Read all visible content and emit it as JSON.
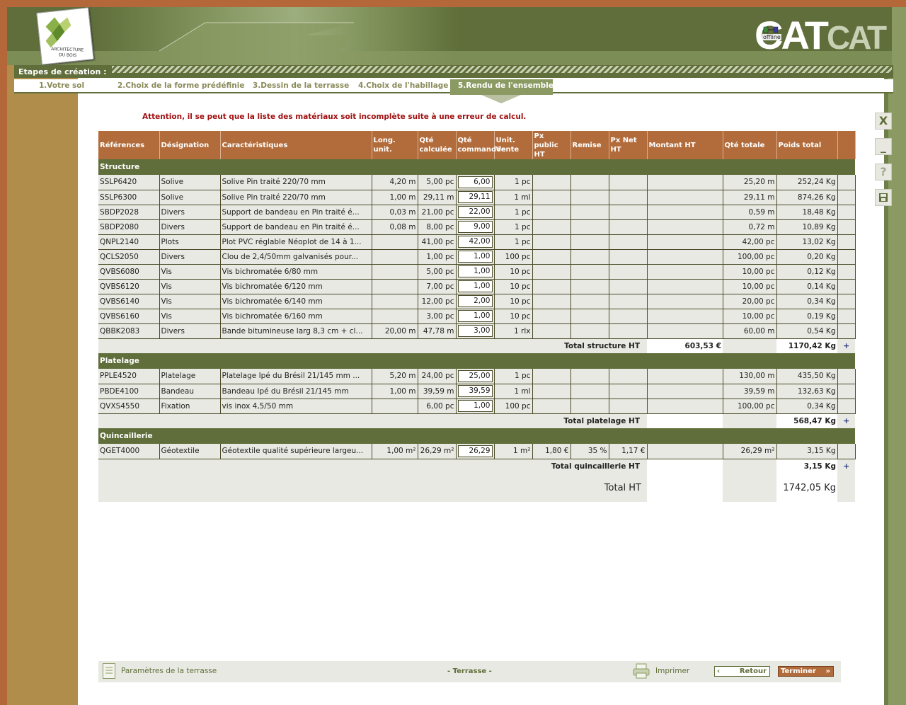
{
  "header": {
    "logo_text": "ARCHITECTURE DU BOIS",
    "brand": "CAT",
    "brand_faded": "CAT",
    "offline_label": "offline"
  },
  "steps": {
    "label": "Etapes de création :",
    "items": [
      {
        "label": "1.Votre  sol"
      },
      {
        "label": "2.Choix de la forme prédéfinie"
      },
      {
        "label": "3.Dessin de la terrasse"
      },
      {
        "label": "4.Choix de l'habillage"
      },
      {
        "label": "5.Rendu de l'ensemble",
        "active": true
      }
    ]
  },
  "warning": "Attention, il se peut que la liste des matériaux soit incomplète suite à une erreur de calcul.",
  "tools": {
    "close": "X",
    "minimize": "_",
    "help": "?",
    "save": "save-icon"
  },
  "table": {
    "headers": {
      "ref": "Références",
      "des": "Désignation",
      "car": "Caractéristiques",
      "long": "Long. unit.",
      "qcalc": "Qté calculée",
      "qcmd": "Qté commandée",
      "unit": "Unit. Vente",
      "pxpub": "Px public HT",
      "remise": "Remise",
      "pxnet": "Px Net HT",
      "montant": "Montant HT",
      "qtot": "Qté totale",
      "poids": "Poids total"
    },
    "sections": [
      {
        "title": "Structure",
        "rows": [
          [
            "SSLP6420",
            "Solive",
            "Solive Pin traité 220/70 mm",
            "4,20 m",
            "5,00 pc",
            "6,00",
            "1 pc",
            "",
            "",
            "",
            "",
            "25,20 m",
            "252,24 Kg"
          ],
          [
            "SSLP6300",
            "Solive",
            "Solive Pin traité 220/70 mm",
            "1,00 m",
            "29,11 m",
            "29,11",
            "1 ml",
            "",
            "",
            "",
            "",
            "29,11 m",
            "874,26 Kg"
          ],
          [
            "SBDP2028",
            "Divers",
            "Support de bandeau en Pin traité é...",
            "0,03 m",
            "21,00 pc",
            "22,00",
            "1 pc",
            "",
            "",
            "",
            "",
            "0,59 m",
            "18,48 Kg"
          ],
          [
            "SBDP2080",
            "Divers",
            "Support de bandeau en Pin traité é...",
            "0,08 m",
            "8,00 pc",
            "9,00",
            "1 pc",
            "",
            "",
            "",
            "",
            "0,72 m",
            "10,89 Kg"
          ],
          [
            "QNPL2140",
            "Plots",
            "Plot PVC réglable Néoplot de 14 à 1...",
            "",
            "41,00 pc",
            "42,00",
            "1 pc",
            "",
            "",
            "",
            "",
            "42,00 pc",
            "13,02 Kg"
          ],
          [
            "QCLS2050",
            "Divers",
            "Clou de 2,4/50mm galvanisés pour...",
            "",
            "1,00 pc",
            "1,00",
            "100 pc",
            "",
            "",
            "",
            "",
            "100,00 pc",
            "0,20 Kg"
          ],
          [
            "QVBS6080",
            "Vis",
            "Vis bichromatée 6/80 mm",
            "",
            "5,00 pc",
            "1,00",
            "10 pc",
            "",
            "",
            "",
            "",
            "10,00 pc",
            "0,12 Kg"
          ],
          [
            "QVBS6120",
            "Vis",
            "Vis bichromatée 6/120 mm",
            "",
            "7,00 pc",
            "1,00",
            "10 pc",
            "",
            "",
            "",
            "",
            "10,00 pc",
            "0,14 Kg"
          ],
          [
            "QVBS6140",
            "Vis",
            "Vis bichromatée 6/140 mm",
            "",
            "12,00 pc",
            "2,00",
            "10 pc",
            "",
            "",
            "",
            "",
            "20,00 pc",
            "0,34 Kg"
          ],
          [
            "QVBS6160",
            "Vis",
            "Vis bichromatée 6/160 mm",
            "",
            "3,00 pc",
            "1,00",
            "10 pc",
            "",
            "",
            "",
            "",
            "10,00 pc",
            "0,19 Kg"
          ],
          [
            "QBBK2083",
            "Divers",
            "Bande bitumineuse larg 8,3 cm + cl...",
            "20,00 m",
            "47,78 m",
            "3,00",
            "1 rlx",
            "",
            "",
            "",
            "",
            "60,00 m",
            "0,54 Kg"
          ]
        ],
        "total_label": "Total structure HT",
        "total_amount": "603,53 €",
        "total_weight": "1170,42 Kg"
      },
      {
        "title": "Platelage",
        "rows": [
          [
            "PPLE4520",
            "Platelage",
            "Platelage Ipé du Brésil 21/145 mm ...",
            "5,20 m",
            "24,00 pc",
            "25,00",
            "1 pc",
            "",
            "",
            "",
            "",
            "130,00 m",
            "435,50 Kg"
          ],
          [
            "PBDE4100",
            "Bandeau",
            "Bandeau Ipé du Brésil 21/145 mm",
            "1,00 m",
            "39,59 m",
            "39,59",
            "1 ml",
            "",
            "",
            "",
            "",
            "39,59 m",
            "132,63 Kg"
          ],
          [
            "QVXS4550",
            "Fixation",
            "vis inox 4,5/50 mm",
            "",
            "6,00 pc",
            "1,00",
            "100 pc",
            "",
            "",
            "",
            "",
            "100,00 pc",
            "0,34 Kg"
          ]
        ],
        "total_label": "Total platelage HT",
        "total_amount": "",
        "total_weight": "568,47 Kg"
      },
      {
        "title": "Quincaillerie",
        "rows": [
          [
            "QGET4000",
            "Géotextile",
            "Géotextile qualité supérieure largeu...",
            "1,00 m²",
            "26,29 m²",
            "26,29",
            "1 m²",
            "1,80 €",
            "35 %",
            "1,17 €",
            "",
            "26,29 m²",
            "3,15 Kg"
          ]
        ],
        "total_label": "Total quincaillerie HT",
        "total_amount": "",
        "total_weight": "3,15 Kg"
      }
    ],
    "grand_total_label": "Total HT",
    "grand_total_weight": "1742,05 Kg"
  },
  "footer": {
    "params_label": "Paramètres de la terrasse",
    "terrasse_label": "- Terrasse -",
    "print_label": "Imprimer",
    "back_label": "Retour",
    "finish_label": "Terminer"
  }
}
